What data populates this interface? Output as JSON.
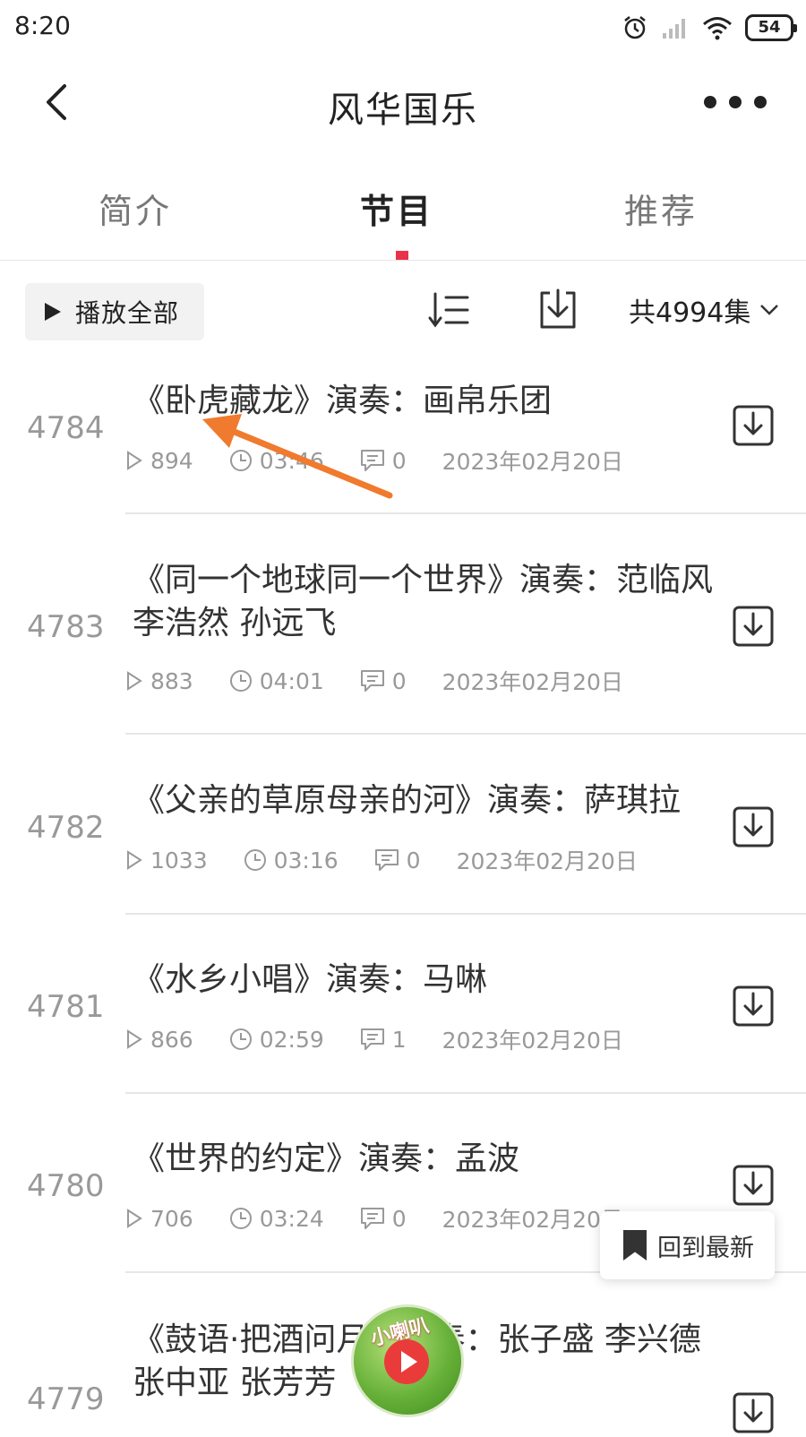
{
  "status_bar": {
    "time": "8:20",
    "battery": "54"
  },
  "header": {
    "title": "风华国乐"
  },
  "tabs": [
    {
      "label": "简介",
      "active": false
    },
    {
      "label": "节目",
      "active": true
    },
    {
      "label": "推荐",
      "active": false
    }
  ],
  "toolbar": {
    "play_all_label": "播放全部",
    "count_label": "共4994集"
  },
  "episodes": [
    {
      "num": "4784",
      "title": "《卧虎藏龙》演奏：画帛乐团",
      "plays": "894",
      "duration": "03:46",
      "comments": "0",
      "date": "2023年02月20日"
    },
    {
      "num": "4783",
      "title": "《同一个地球同一个世界》演奏：范临风 李浩然 孙远飞",
      "plays": "883",
      "duration": "04:01",
      "comments": "0",
      "date": "2023年02月20日"
    },
    {
      "num": "4782",
      "title": "《父亲的草原母亲的河》演奏：萨琪拉",
      "plays": "1033",
      "duration": "03:16",
      "comments": "0",
      "date": "2023年02月20日"
    },
    {
      "num": "4781",
      "title": "《水乡小唱》演奏：马啉",
      "plays": "866",
      "duration": "02:59",
      "comments": "1",
      "date": "2023年02月20日"
    },
    {
      "num": "4780",
      "title": "《世界的约定》演奏：孟波",
      "plays": "706",
      "duration": "03:24",
      "comments": "0",
      "date": "2023年02月20日"
    },
    {
      "num": "4779",
      "title": "《鼓语·把酒问月》演奏：张子盛 李兴德 张中亚 张芳芳"
    }
  ],
  "floating": {
    "back_latest_label": "回到最新",
    "player_badge": "小喇叭"
  },
  "colors": {
    "accent": "#e8334a",
    "annotation_arrow": "#f07a2e"
  },
  "icons": [
    "back-arrow-icon",
    "more-dots-icon",
    "play-triangle-icon",
    "sort-icon",
    "download-icon",
    "play-count-icon",
    "clock-icon",
    "comment-icon",
    "bookmark-icon",
    "chevron-down-icon"
  ]
}
